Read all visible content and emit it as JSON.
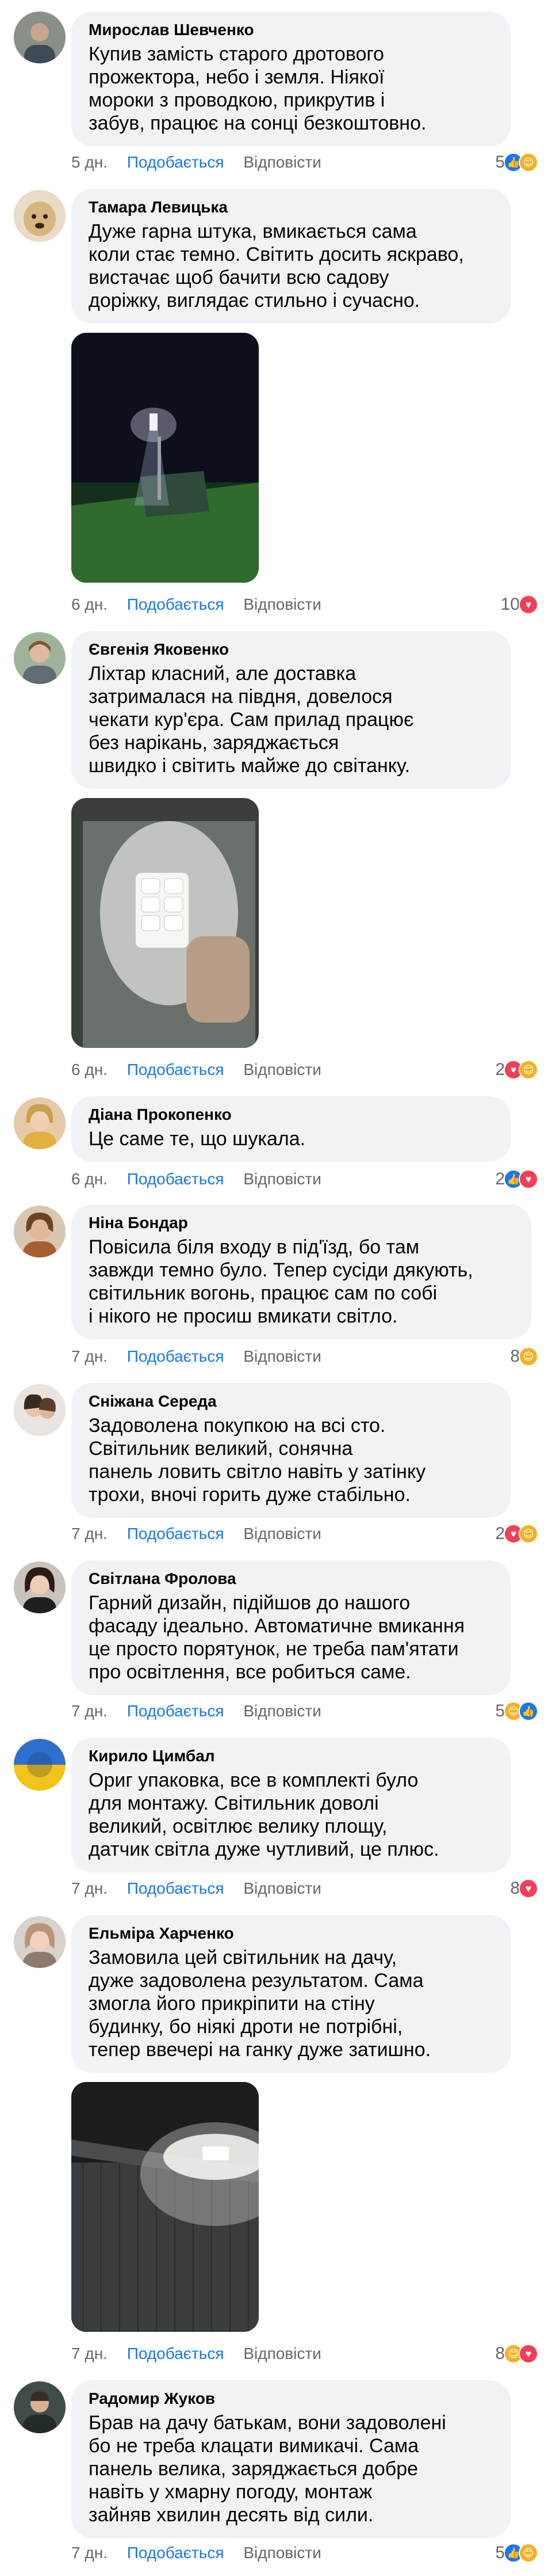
{
  "labels": {
    "like": "Подобається",
    "reply": "Відповісти"
  },
  "comments": [
    {
      "author": "Мирослав Шевченко",
      "text": "Купив замість старого дротового\nпрожектора, небо і земля. Ніякої\nмороки з проводкою, прикрутив і\nзабув, працює на сонці безкоштовно.",
      "time": "5 дн.",
      "reactions_count": "5",
      "reactions": [
        "like-icon",
        "care-icon"
      ]
    },
    {
      "author": "Тамара Левицька",
      "text": "Дуже гарна штука, вмикається сама\nколи стає темно. Світить досить яскраво,\nвистачає щоб бачити всю садову\nдоріжку, виглядає стильно і сучасно.",
      "time": "6 дн.",
      "reactions_count": "10",
      "reactions": [
        "love-icon"
      ]
    },
    {
      "author": "Євгенія Яковенко",
      "text": "Ліхтар класний, але доставка\nзатрималася на півдня, довелося\nчекати кур'єра. Сам прилад працює\nбез нарікань, заряджається\nшвидко і світить майже до світанку.",
      "time": "6 дн.",
      "reactions_count": "2",
      "reactions": [
        "love-icon",
        "care-icon"
      ]
    },
    {
      "author": "Діана Прокопенко",
      "text": "Це саме те, що шукала.",
      "time": "6 дн.",
      "reactions_count": "2",
      "reactions": [
        "like-icon",
        "love-icon"
      ]
    },
    {
      "author": "Ніна Бондар",
      "text": "Повісила біля входу в під'їзд, бо там\nзавжди темно було. Тепер сусіди дякують,\nсвітильник вогонь, працює сам по собі\nі нікого не просиш вмикати світло.",
      "time": "7 дн.",
      "reactions_count": "8",
      "reactions": [
        "care-icon"
      ]
    },
    {
      "author": "Сніжана Середа",
      "text": "Задоволена покупкою на всі сто.\nСвітильник великий, сонячна\nпанель ловить світло навіть у затінку\nтрохи, вночі горить дуже стабільно.",
      "time": "7 дн.",
      "reactions_count": "2",
      "reactions": [
        "love-icon",
        "care-icon"
      ]
    },
    {
      "author": "Світлана Фролова",
      "text": "Гарний дизайн, підійшов до нашого\nфасаду ідеально. Автоматичне вмикання\nце просто порятунок, не треба пам'ятати\nпро освітлення, все робиться саме.",
      "time": "7 дн.",
      "reactions_count": "5",
      "reactions": [
        "care-icon",
        "like-icon"
      ]
    },
    {
      "author": "Кирило Цимбал",
      "text": "Ориг упаковка, все в комплекті було\nдля монтажу. Світильник доволі\nвеликий, освітлює велику площу,\nдатчик світла дуже чутливий, це плюс.",
      "time": "7 дн.",
      "reactions_count": "8",
      "reactions": [
        "love-icon"
      ]
    },
    {
      "author": "Ельміра Харченко",
      "text": "Замовила цей світильник на дачу,\nдуже задоволена результатом. Сама\nзмогла його прикріпити на стіну\nбудинку, бо ніякі дроти не потрібні,\nтепер ввечері на ганку дуже затишно.",
      "time": "7 дн.",
      "reactions_count": "8",
      "reactions": [
        "care-icon",
        "love-icon"
      ]
    },
    {
      "author": "Радомир Жуков",
      "text": "Брав на дачу батькам, вони задоволені\nбо не треба клацати вимикачі. Сама\nпанель велика, заряджається добре\nнавіть у хмарну погоду, монтаж\nзайняв хвилин десять від сили.",
      "time": "7 дн.",
      "reactions_count": "5",
      "reactions": [
        "like-icon",
        "care-icon"
      ]
    }
  ],
  "colors": {
    "bubble": "#f0f2f5",
    "like": "#1877f2",
    "meta": "#65676b"
  }
}
